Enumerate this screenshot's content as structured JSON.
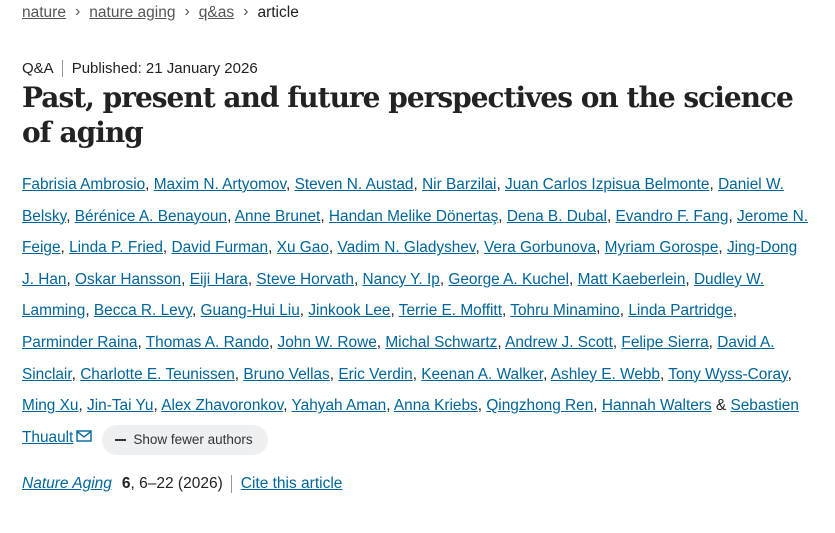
{
  "breadcrumb": [
    {
      "label": "nature"
    },
    {
      "label": "nature aging"
    },
    {
      "label": "q&as"
    },
    {
      "label": "article"
    }
  ],
  "meta": {
    "type": "Q&A",
    "published": "Published: 21 January 2026"
  },
  "title": "Past, present and future perspectives on the science of aging",
  "authors": [
    "Fabrisia Ambrosio",
    "Maxim N. Artyomov",
    "Steven N. Austad",
    "Nir Barzilai",
    "Juan Carlos Izpisua Belmonte",
    "Daniel W. Belsky",
    "Bérénice A. Benayoun",
    "Anne Brunet",
    "Handan Melike Dönertaş",
    "Dena B. Dubal",
    "Evandro F. Fang",
    "Jerome N. Feige",
    "Linda P. Fried",
    "David Furman",
    "Xu Gao",
    "Vadim N. Gladyshev",
    "Vera Gorbunova",
    "Myriam Gorospe",
    "Jing-Dong J. Han",
    "Oskar Hansson",
    "Eiji Hara",
    "Steve Horvath",
    "Nancy Y. Ip",
    "George A. Kuchel",
    "Matt Kaeberlein",
    "Dudley W. Lamming",
    "Becca R. Levy",
    "Guang-Hui Liu",
    "Jinkook Lee",
    "Terrie E. Moffitt",
    "Tohru Minamino",
    "Linda Partridge",
    "Parminder Raina",
    "Thomas A. Rando",
    "John W. Rowe",
    "Michal Schwartz",
    "Andrew J. Scott",
    "Felipe Sierra",
    "David A. Sinclair",
    "Charlotte E. Teunissen",
    "Bruno Vellas",
    "Eric Verdin",
    "Keenan A. Walker",
    "Ashley E. Webb",
    "Tony Wyss-Coray",
    "Ming Xu",
    "Jin-Tai Yu",
    "Alex Zhavoronkov",
    "Yahyah Aman",
    "Anna Kriebs",
    "Qingzhong Ren",
    "Hannah Walters",
    "Sebastien Thuault"
  ],
  "authors_separator": ", ",
  "authors_last_joiner": " & ",
  "show_fewer_label": "Show fewer authors",
  "citation": {
    "journal": "Nature Aging",
    "volume": "6",
    "pages": ", 6–22 (2026)",
    "cite_label": "Cite this article"
  }
}
